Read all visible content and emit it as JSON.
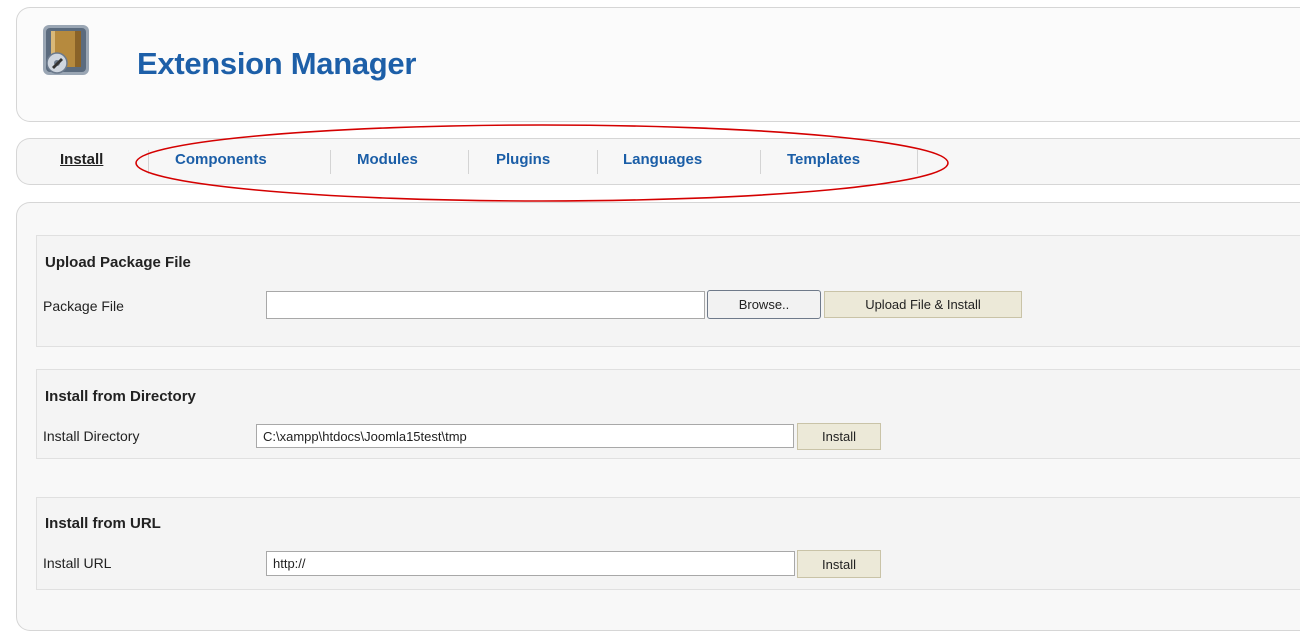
{
  "header": {
    "title": "Extension Manager",
    "icon": "extension-box-icon"
  },
  "tabs": [
    {
      "label": "Install",
      "active": true
    },
    {
      "label": "Components",
      "active": false
    },
    {
      "label": "Modules",
      "active": false
    },
    {
      "label": "Plugins",
      "active": false
    },
    {
      "label": "Languages",
      "active": false
    },
    {
      "label": "Templates",
      "active": false
    }
  ],
  "upload": {
    "title": "Upload Package File",
    "label": "Package File",
    "value": "",
    "browse_label": "Browse..",
    "submit_label": "Upload File & Install"
  },
  "directory": {
    "title": "Install from Directory",
    "label": "Install Directory",
    "value": "C:\\xampp\\htdocs\\Joomla15test\\tmp",
    "submit_label": "Install"
  },
  "url": {
    "title": "Install from URL",
    "label": "Install URL",
    "value": "http://",
    "submit_label": "Install"
  },
  "colors": {
    "title_blue": "#1d5fa8",
    "tab_blue": "#1b5ea7",
    "highlight_red": "#d40000"
  }
}
